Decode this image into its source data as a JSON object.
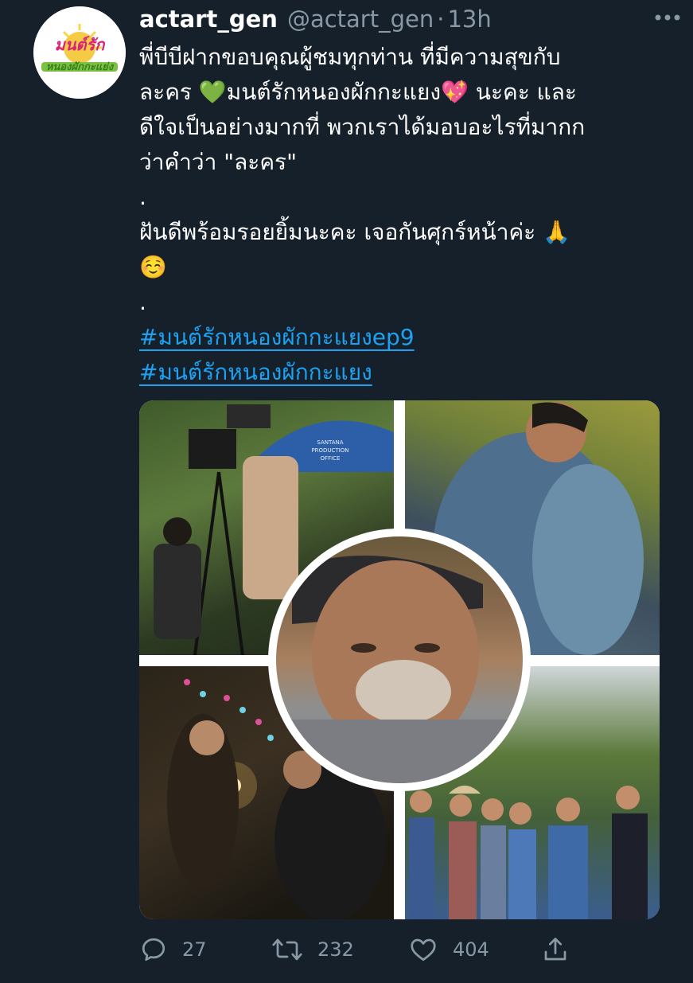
{
  "tweet": {
    "display_name": "actart_gen",
    "handle": "@actart_gen",
    "separator": "·",
    "time": "13h",
    "avatar_text": [
      "มนต์รัก",
      "หนองผักกะแย่ง"
    ],
    "lines": [
      "พี่บีบีฝากขอบคุณผู้ชมทุกท่าน ที่มีความสุขกับ",
      "ละคร 💚มนต์รักหนองผักกะแยง💖 นะคะ และ",
      "ดีใจเป็นอย่างมากที่  พวกเราได้มอบอะไรที่มากก",
      "ว่าคำว่า \"ละคร\"",
      ".",
      "ฝันดีพร้อมรอยยิ้มนะคะ เจอกันศุกร์หน้าค่ะ 🙏",
      "☺️",
      "."
    ],
    "hashtags": [
      "#มนต์รักหนองผักกะแยงep9",
      "#มนต์รักหนองผักกะแยง"
    ],
    "umbrella_text": [
      "SANTANA",
      "PRODUCTION",
      "OFFICE"
    ]
  },
  "actions": {
    "reply_count": "27",
    "retweet_count": "232",
    "like_count": "404"
  },
  "icons": {
    "more": "more-horizontal-icon",
    "reply": "reply-icon",
    "retweet": "retweet-icon",
    "like": "like-icon",
    "share": "share-icon"
  },
  "colors": {
    "background": "#15202b",
    "text": "#ffffff",
    "secondary": "#8899a6",
    "link": "#1da1f2"
  }
}
